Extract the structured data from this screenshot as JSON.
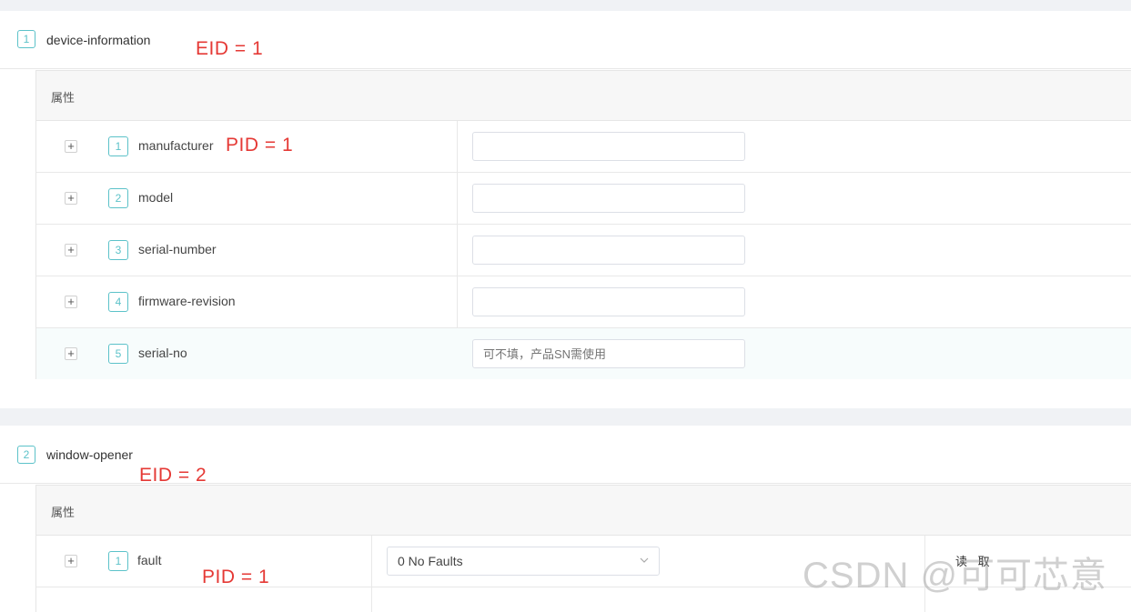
{
  "sections": [
    {
      "number": "1",
      "title": "device-information",
      "annotation": "EID = 1",
      "table_header": "属性",
      "rows": [
        {
          "number": "1",
          "name": "manufacturer",
          "value": "",
          "annotation": "PID = 1"
        },
        {
          "number": "2",
          "name": "model",
          "value": ""
        },
        {
          "number": "3",
          "name": "serial-number",
          "value": ""
        },
        {
          "number": "4",
          "name": "firmware-revision",
          "value": ""
        },
        {
          "number": "5",
          "name": "serial-no",
          "value": "",
          "placeholder": "可不填，产品SN需使用"
        }
      ]
    },
    {
      "number": "2",
      "title": "window-opener",
      "annotation": "EID = 2",
      "table_header": "属性",
      "rows": [
        {
          "number": "1",
          "name": "fault",
          "selected": "0 No Faults",
          "action": "读 取",
          "annotation": "PID = 1"
        }
      ]
    }
  ],
  "expand_symbol": "+",
  "watermark": "CSDN @可可芯意",
  "icons": {
    "expand": "plus-icon",
    "dropdown": "chevron-down-icon"
  },
  "colors": {
    "badge": "#5cc2c9",
    "annotation": "#e53935",
    "background_band": "#f0f2f5"
  }
}
